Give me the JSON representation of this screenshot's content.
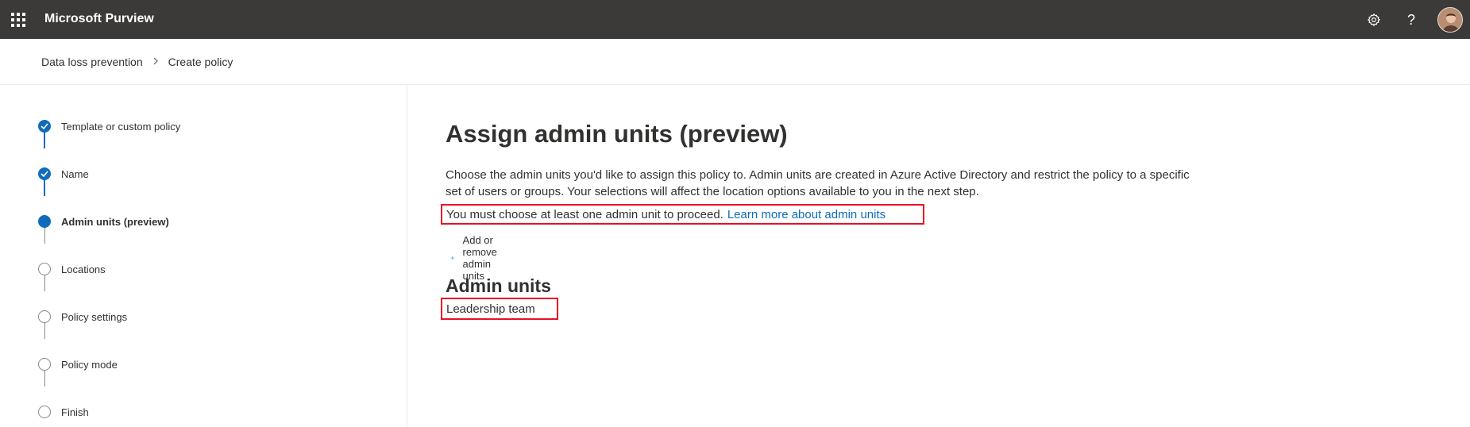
{
  "topbar": {
    "app_title": "Microsoft Purview",
    "icons": [
      "app-launcher-icon",
      "settings-icon",
      "help-icon",
      "avatar"
    ]
  },
  "breadcrumb": {
    "items": [
      "Data loss prevention",
      "Create policy"
    ]
  },
  "wizard": {
    "steps": [
      {
        "label": "Template or custom policy",
        "state": "completed"
      },
      {
        "label": "Name",
        "state": "completed"
      },
      {
        "label": "Admin units (preview)",
        "state": "current"
      },
      {
        "label": "Locations",
        "state": "not-started"
      },
      {
        "label": "Policy settings",
        "state": "not-started"
      },
      {
        "label": "Policy mode",
        "state": "not-started"
      },
      {
        "label": "Finish",
        "state": "not-started"
      }
    ]
  },
  "main": {
    "title": "Assign admin units (preview)",
    "description": "Choose the admin units you'd like to assign this policy to. Admin units are created in Azure Active Directory and restrict the policy to a specific set of users or groups. Your selections will affect the location options available to you in the next step.",
    "warning_text": "You must choose at least one admin unit to proceed.",
    "warning_link": "Learn more about admin units",
    "add_button_label": "Add or remove admin units",
    "section_title": "Admin units",
    "selected_units": [
      "Leadership team"
    ]
  },
  "colors": {
    "topbar": "#3b3a39",
    "accent": "#0f6cbd",
    "highlight": "#e81123"
  }
}
